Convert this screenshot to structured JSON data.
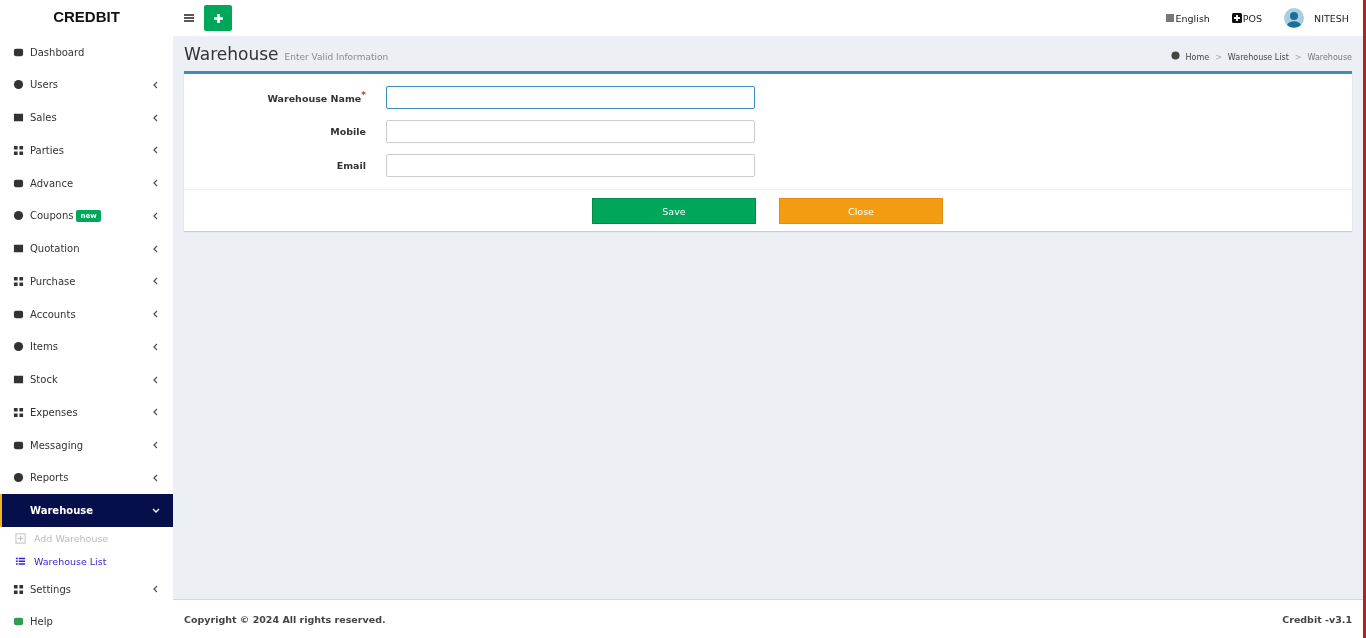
{
  "brand": "CREDBIT",
  "header": {
    "language": "English",
    "pos": "POS",
    "user": "NITESH"
  },
  "sidebar": {
    "items": [
      {
        "label": "Dashboard",
        "expandable": false,
        "selected": false
      },
      {
        "label": "Users",
        "expandable": true,
        "selected": false
      },
      {
        "label": "Sales",
        "expandable": true,
        "selected": false
      },
      {
        "label": "Parties",
        "expandable": true,
        "selected": false
      },
      {
        "label": "Advance",
        "expandable": true,
        "selected": false
      },
      {
        "label": "Coupons",
        "badge": "new",
        "expandable": true,
        "selected": false
      },
      {
        "label": "Quotation",
        "expandable": true,
        "selected": false
      },
      {
        "label": "Purchase",
        "expandable": true,
        "selected": false
      },
      {
        "label": "Accounts",
        "expandable": true,
        "selected": false
      },
      {
        "label": "Items",
        "expandable": true,
        "selected": false
      },
      {
        "label": "Stock",
        "expandable": true,
        "selected": false
      },
      {
        "label": "Expenses",
        "expandable": true,
        "selected": false
      },
      {
        "label": "Messaging",
        "expandable": true,
        "selected": false
      },
      {
        "label": "Reports",
        "expandable": true,
        "selected": false
      },
      {
        "label": "Warehouse",
        "expandable": true,
        "selected": true,
        "expanded": true,
        "children": [
          {
            "label": "Add Warehouse",
            "selected": true
          },
          {
            "label": "Warehouse List",
            "selected": false
          }
        ]
      },
      {
        "label": "Settings",
        "expandable": true,
        "selected": false
      },
      {
        "label": "Help",
        "expandable": false,
        "selected": false
      }
    ]
  },
  "page": {
    "title": "Warehouse",
    "subtitle": "Enter Valid Information"
  },
  "breadcrumb": {
    "items": [
      "Home",
      "Warehouse List",
      "Warehouse"
    ],
    "separator": ">"
  },
  "form": {
    "required_mark": "*",
    "fields": [
      {
        "label": "Warehouse Name",
        "required": true,
        "focused": true
      },
      {
        "label": "Mobile",
        "required": false,
        "focused": false
      },
      {
        "label": "Email",
        "required": false,
        "focused": false
      }
    ],
    "buttons": [
      {
        "label": "Save",
        "kind": "primary"
      },
      {
        "label": "Close",
        "kind": "warning"
      }
    ]
  },
  "footer": {
    "copyright": "Copyright © 2024 All rights reserved.",
    "version": "Credbit -v3.1"
  }
}
